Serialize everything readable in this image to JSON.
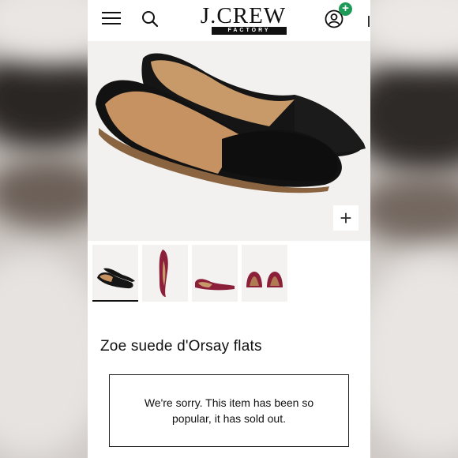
{
  "header": {
    "brand": "J.CREW",
    "sub_brand": "FACTORY",
    "account_badge": "+"
  },
  "hero": {
    "zoom_label": "+"
  },
  "thumbnails": [
    {
      "color": "black",
      "selected": true
    },
    {
      "color": "burgundy",
      "selected": false
    },
    {
      "color": "burgundy",
      "selected": false
    },
    {
      "color": "burgundy",
      "selected": false
    }
  ],
  "product": {
    "title": "Zoe suede d'Orsay flats"
  },
  "sold_out": {
    "message": "We're sorry. This item has been so popular, it has sold out."
  },
  "colors": {
    "accent_green": "#1e9a57",
    "shoe_black": "#151515",
    "shoe_burgundy": "#8c1f3a",
    "lining_tan": "#c89a6a"
  }
}
